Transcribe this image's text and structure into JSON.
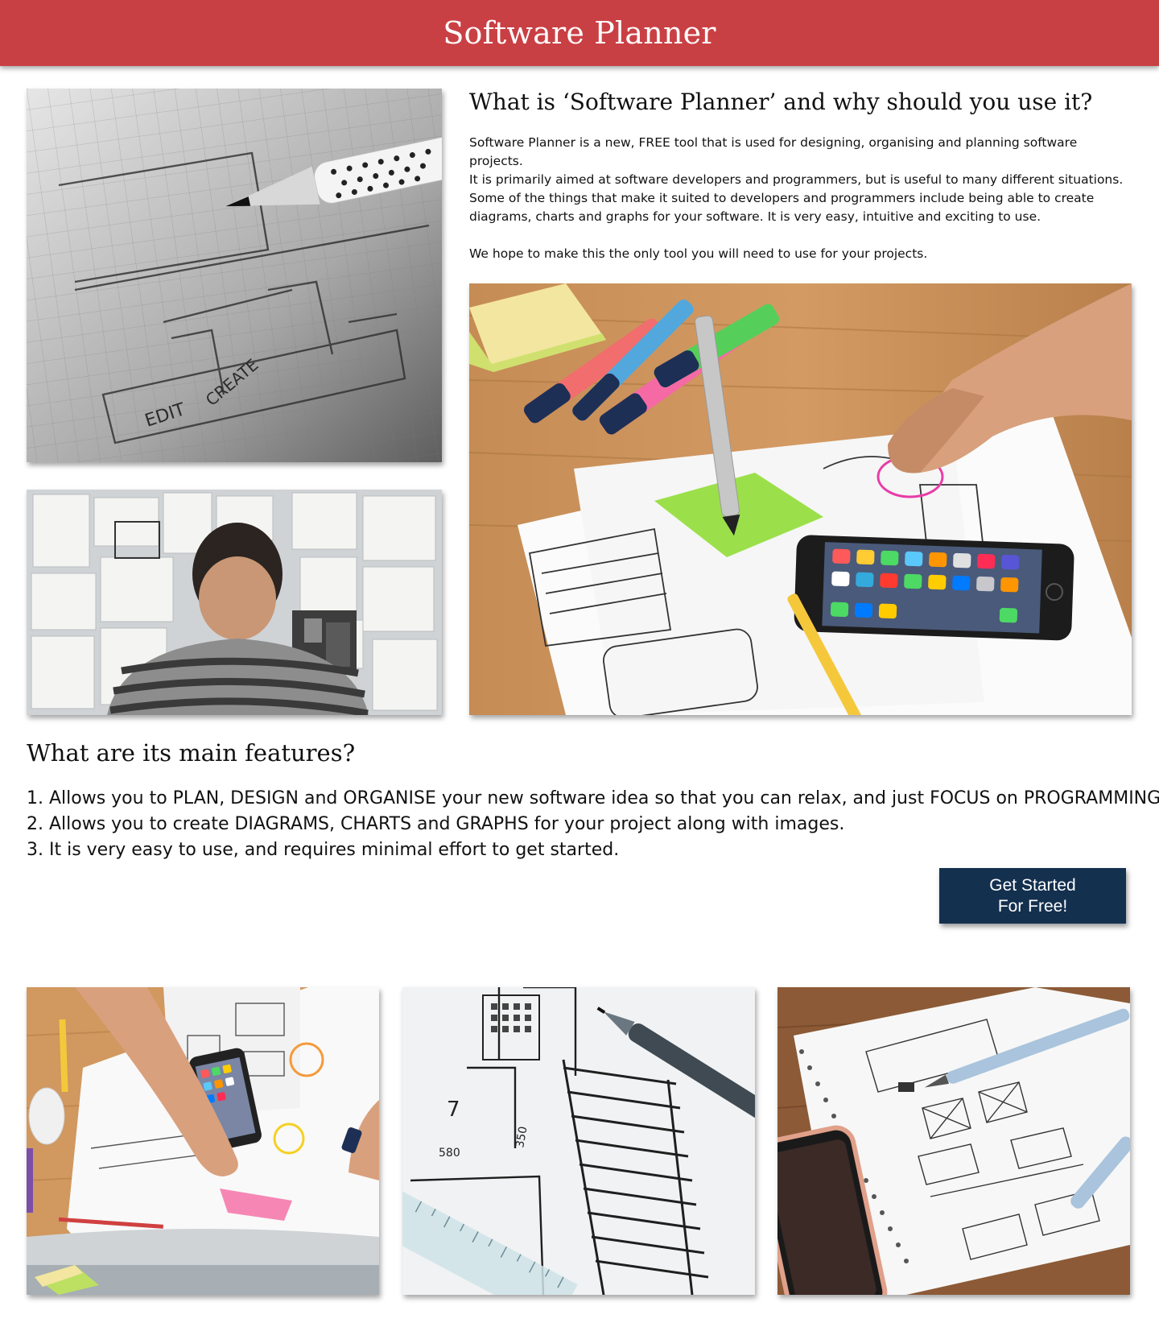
{
  "header": {
    "title": "Software Planner"
  },
  "intro": {
    "title": "What is ‘Software Planner’ and why should you use it?",
    "paragraphs": [
      [
        "Software Planner is a new, FREE tool that is used for designing, organising and planning software projects.",
        "It is primarily aimed at software developers and programmers, but is useful to many different situations."
      ],
      [
        "Some of the things that make it suited to developers and programmers include being able to create",
        "diagrams, charts and graphs for your software. It is very easy, intuitive and exciting to use."
      ],
      [
        "We hope to make this the only tool you will need to use for your projects."
      ]
    ]
  },
  "features": {
    "title": "What are its main features?",
    "items": [
      "1. Allows you to PLAN, DESIGN and ORGANISE your new software idea so that you can relax, and just FOCUS on PROGRAMMING",
      "2. Allows you to create DIAGRAMS, CHARTS and GRAPHS for your project along with images.",
      "3. It is very easy to use, and requires minimal effort to get started."
    ]
  },
  "cta": {
    "line1": "Get Started",
    "line2": "For Free!"
  },
  "images": [
    {
      "name": "sketch-pencil-image",
      "sketch_text": [
        "EDIT",
        "CREATE"
      ]
    },
    {
      "name": "man-wall-of-sketches-image"
    },
    {
      "name": "hand-drawing-wireframe-image"
    },
    {
      "name": "desk-sketching-image"
    },
    {
      "name": "blueprint-pen-image",
      "sketch_text": [
        "7",
        "580",
        "350"
      ]
    },
    {
      "name": "notebook-wireframe-image"
    }
  ],
  "colors": {
    "header_bg": "#c94044",
    "cta_bg": "#14304f",
    "text": "#111111"
  }
}
